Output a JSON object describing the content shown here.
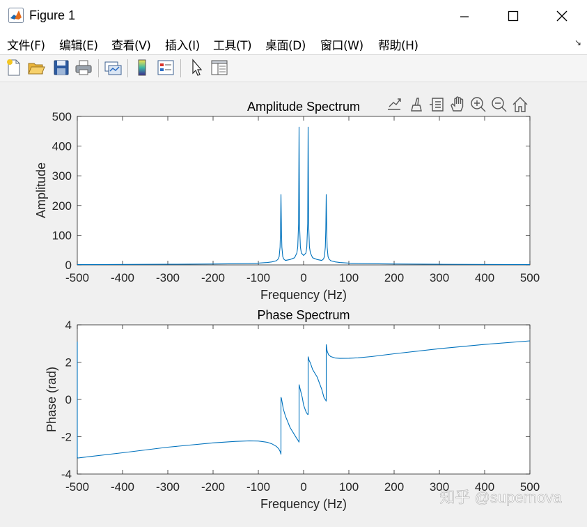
{
  "window": {
    "title": "Figure 1",
    "app_icon": "matlab-logo-icon",
    "controls": [
      "minimize-icon",
      "maximize-icon",
      "close-icon"
    ]
  },
  "menu": {
    "items": [
      {
        "label": "文件(F)"
      },
      {
        "label": "编辑(E)"
      },
      {
        "label": "查看(V)"
      },
      {
        "label": "插入(I)"
      },
      {
        "label": "工具(T)"
      },
      {
        "label": "桌面(D)"
      },
      {
        "label": "窗口(W)"
      },
      {
        "label": "帮助(H)"
      }
    ],
    "dock_arrow": "↘"
  },
  "toolbar": {
    "buttons": [
      "new-figure-icon",
      "open-file-icon",
      "save-icon",
      "print-icon",
      "link-plot-icon",
      "colorbar-icon",
      "legend-icon",
      "edit-plot-icon",
      "property-inspector-icon"
    ]
  },
  "axes_toolbar": {
    "buttons": [
      "export-icon",
      "brush-icon",
      "datatip-icon",
      "pan-icon",
      "zoom-in-icon",
      "zoom-out-icon",
      "home-icon"
    ]
  },
  "watermark": "知乎 @supernova",
  "colors": {
    "line": "#0072bd",
    "axes_bg": "#ffffff",
    "figure_bg": "#f0f0f0",
    "text": "#262626"
  },
  "chart_data": [
    {
      "type": "line",
      "title": "Amplitude Spectrum",
      "xlabel": "Frequency (Hz)",
      "ylabel": "Amplitude",
      "xlim": [
        -500,
        500
      ],
      "ylim": [
        0,
        500
      ],
      "xticks": [
        -500,
        -400,
        -300,
        -200,
        -100,
        0,
        100,
        200,
        300,
        400,
        500
      ],
      "yticks": [
        0,
        100,
        200,
        300,
        400,
        500
      ],
      "grid": false,
      "series": [
        {
          "x": [
            -500,
            -300,
            -200,
            -150,
            -120,
            -100,
            -80,
            -70,
            -60,
            -56,
            -54,
            -52,
            -51,
            -50,
            -49,
            -48,
            -46,
            -44,
            -40,
            -30,
            -20,
            -15,
            -13,
            -11,
            -10,
            -9,
            -7,
            -5,
            0,
            5,
            7,
            9,
            10,
            11,
            13,
            15,
            20,
            30,
            40,
            44,
            46,
            48,
            49,
            50,
            51,
            52,
            54,
            56,
            60,
            70,
            80,
            100,
            120,
            150,
            200,
            300,
            500
          ],
          "y": [
            1,
            2,
            3,
            4,
            5,
            6,
            8,
            10,
            14,
            20,
            28,
            60,
            120,
            238,
            120,
            60,
            28,
            20,
            15,
            18,
            24,
            40,
            60,
            140,
            465,
            140,
            60,
            40,
            32,
            40,
            60,
            140,
            465,
            140,
            60,
            40,
            24,
            18,
            15,
            20,
            28,
            60,
            120,
            238,
            120,
            60,
            28,
            20,
            14,
            10,
            8,
            6,
            5,
            4,
            3,
            2,
            1
          ]
        }
      ]
    },
    {
      "type": "line",
      "title": "Phase Spectrum",
      "xlabel": "Frequency (Hz)",
      "ylabel": "Phase (rad)",
      "xlim": [
        -500,
        500
      ],
      "ylim": [
        -4,
        4
      ],
      "xticks": [
        -500,
        -400,
        -300,
        -200,
        -100,
        0,
        100,
        200,
        300,
        400,
        500
      ],
      "yticks": [
        -4,
        -2,
        0,
        2,
        4
      ],
      "grid": false,
      "series": [
        {
          "x": [
            -500,
            -500,
            -499,
            -400,
            -300,
            -200,
            -150,
            -120,
            -100,
            -80,
            -70,
            -60,
            -55,
            -52,
            -51,
            -50,
            -50,
            -49,
            -45,
            -40,
            -30,
            -20,
            -15,
            -12,
            -10,
            -10,
            -9,
            -6,
            -3,
            0,
            3,
            6,
            9,
            10,
            10,
            12,
            15,
            20,
            30,
            40,
            45,
            49,
            50,
            50,
            51,
            52,
            55,
            60,
            70,
            80,
            100,
            120,
            150,
            200,
            300,
            400,
            500
          ],
          "y": [
            3.1,
            -3.1,
            -3.14,
            -2.86,
            -2.56,
            -2.33,
            -2.25,
            -2.22,
            -2.23,
            -2.3,
            -2.38,
            -2.52,
            -2.65,
            -2.78,
            -2.85,
            -2.95,
            0.12,
            0.05,
            -0.5,
            -0.9,
            -1.5,
            -1.9,
            -2.1,
            -2.2,
            -2.3,
            0.8,
            0.7,
            0.4,
            0.1,
            -0.3,
            -0.5,
            -0.7,
            -0.8,
            -0.8,
            2.3,
            2.1,
            1.95,
            1.6,
            1.2,
            0.55,
            0.1,
            -0.05,
            -0.1,
            2.95,
            2.75,
            2.6,
            2.4,
            2.3,
            2.22,
            2.2,
            2.21,
            2.23,
            2.3,
            2.45,
            2.72,
            2.95,
            3.14
          ]
        }
      ]
    }
  ]
}
